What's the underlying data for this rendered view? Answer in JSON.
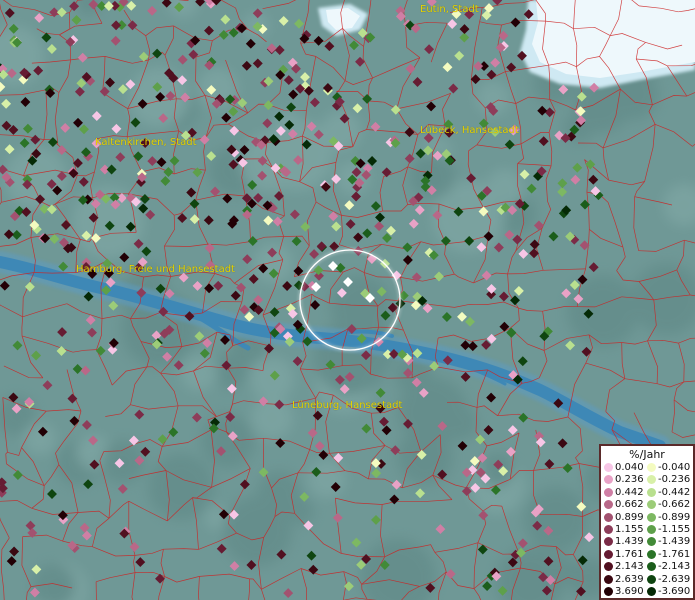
{
  "map": {
    "place_labels": [
      {
        "text": "Eutin, Stadt"
      },
      {
        "text": "Kaltenkirchen, Stadt"
      },
      {
        "text": "Lübeck, Hansestadt"
      },
      {
        "text": "Hamburg, Freie und Hansestadt"
      },
      {
        "text": "Lüneburg, Hansestadt"
      }
    ],
    "colors": {
      "background": "#6f9896",
      "water": "#3e88b6",
      "sea": "#eaf6fb",
      "boundaries": "#cc2222",
      "label": "#e6d400",
      "focus_ring": "#ffffff"
    }
  },
  "legend": {
    "title": "%/Jahr",
    "positive": [
      {
        "label": "0.040",
        "color": "#f7c6e6"
      },
      {
        "label": "0.236",
        "color": "#e9a2c6"
      },
      {
        "label": "0.442",
        "color": "#d07fa5"
      },
      {
        "label": "0.662",
        "color": "#b96888"
      },
      {
        "label": "0.899",
        "color": "#a35270"
      },
      {
        "label": "1.155",
        "color": "#8e3d5a"
      },
      {
        "label": "1.439",
        "color": "#7b2b47"
      },
      {
        "label": "1.761",
        "color": "#661c33"
      },
      {
        "label": "2.143",
        "color": "#511020"
      },
      {
        "label": "2.639",
        "color": "#3b0812"
      },
      {
        "label": "3.690",
        "color": "#220005"
      }
    ],
    "negative": [
      {
        "label": "-0.040",
        "color": "#f4fbc0"
      },
      {
        "label": "-0.236",
        "color": "#d8f0a8"
      },
      {
        "label": "-0.442",
        "color": "#b9e08f"
      },
      {
        "label": "-0.662",
        "color": "#9ccc78"
      },
      {
        "label": "-0.899",
        "color": "#7db862"
      },
      {
        "label": "-1.155",
        "color": "#5ea04a"
      },
      {
        "label": "-1.439",
        "color": "#428a37"
      },
      {
        "label": "-1.761",
        "color": "#2b7428"
      },
      {
        "label": "-2.143",
        "color": "#1b5d1b"
      },
      {
        "label": "-2.639",
        "color": "#0f4510"
      },
      {
        "label": "-3.690",
        "color": "#052a06"
      }
    ]
  }
}
